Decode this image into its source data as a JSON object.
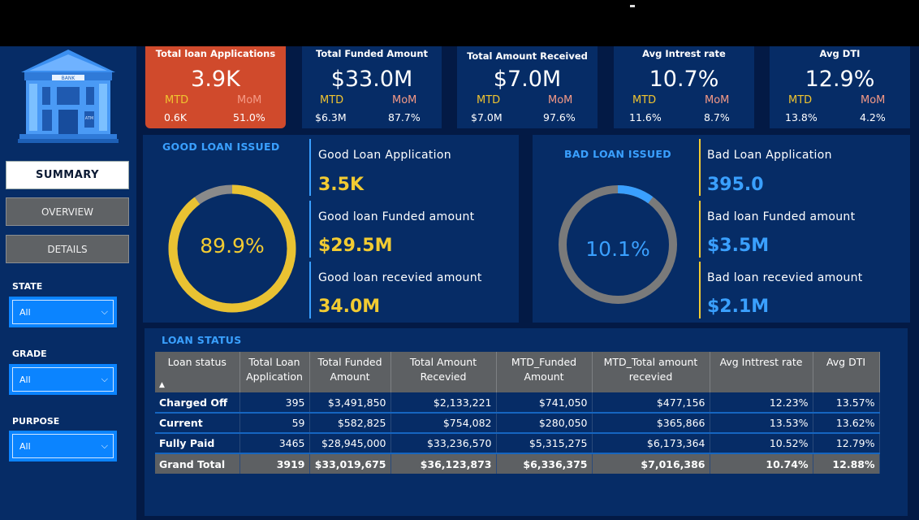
{
  "bank_logo": {
    "sign": "BANK",
    "atm": "ATM"
  },
  "nav": {
    "summary": "SUMMARY",
    "overview": "OVERVIEW",
    "details": "DETAILS"
  },
  "filters": {
    "state": {
      "label": "STATE",
      "value": "All"
    },
    "grade": {
      "label": "GRADE",
      "value": "All"
    },
    "purpose": {
      "label": "PURPOSE",
      "value": "All"
    }
  },
  "kpis": [
    {
      "title": "Total loan Applications",
      "value": "3.9K",
      "mtd_label": "MTD",
      "mom_label": "MoM",
      "mtd": "0.6K",
      "mom": "51.0%"
    },
    {
      "title": "Total Funded Amount",
      "value": "$33.0M",
      "mtd_label": "MTD",
      "mom_label": "MoM",
      "mtd": "$6.3M",
      "mom": "87.7%"
    },
    {
      "title": "Total Amount Received",
      "value": "$7.0M",
      "mtd_label": "MTD",
      "mom_label": "MoM",
      "mtd": "$7.0M",
      "mom": "97.6%"
    },
    {
      "title": "Avg Intrest rate",
      "value": "10.7%",
      "mtd_label": "MTD",
      "mom_label": "MoM",
      "mtd": "11.6%",
      "mom": "8.7%"
    },
    {
      "title": "Avg DTI",
      "value": "12.9%",
      "mtd_label": "MTD",
      "mom_label": "MoM",
      "mtd": "13.8%",
      "mom": "4.2%"
    }
  ],
  "good_loan": {
    "title": "GOOD LOAN ISSUED",
    "percent": "89.9%",
    "percent_value": 0.899,
    "ring_color": "#e9c232",
    "rest_color": "#8a8a8a",
    "app_label": "Good Loan Application",
    "app_value": "3.5K",
    "funded_label": "Good loan Funded amount",
    "funded_value": "$29.5M",
    "received_label": "Good loan recevied amount",
    "received_value": "34.0M"
  },
  "bad_loan": {
    "title": "BAD LOAN ISSUED",
    "percent": "10.1%",
    "percent_value": 0.101,
    "ring_color": "#3aa0ff",
    "rest_color": "#7a7a7a",
    "app_label": "Bad Loan Application",
    "app_value": "395.0",
    "funded_label": "Bad loan Funded amount",
    "funded_value": "$3.5M",
    "received_label": "Bad loan recevied amount",
    "received_value": "$2.1M"
  },
  "loan_status": {
    "title": "LOAN STATUS",
    "sort_indicator": "▲",
    "columns": [
      "Loan status",
      "Total Loan Application",
      "Total Funded Amount",
      "Total Amount Recevied",
      "MTD_Funded Amount",
      "MTD_Total amount recevied",
      "Avg Inttrest rate",
      "Avg DTI"
    ],
    "rows": [
      [
        "Charged Off",
        "395",
        "$3,491,850",
        "$2,133,221",
        "$741,050",
        "$477,156",
        "12.23%",
        "13.57%"
      ],
      [
        "Current",
        "59",
        "$582,825",
        "$754,082",
        "$280,050",
        "$365,866",
        "13.53%",
        "13.62%"
      ],
      [
        "Fully Paid",
        "3465",
        "$28,945,000",
        "$33,236,570",
        "$5,315,275",
        "$6,173,364",
        "10.52%",
        "12.79%"
      ]
    ],
    "total": [
      "Grand Total",
      "3919",
      "$33,019,675",
      "$36,123,873",
      "$6,336,375",
      "$7,016,386",
      "10.74%",
      "12.88%"
    ]
  }
}
